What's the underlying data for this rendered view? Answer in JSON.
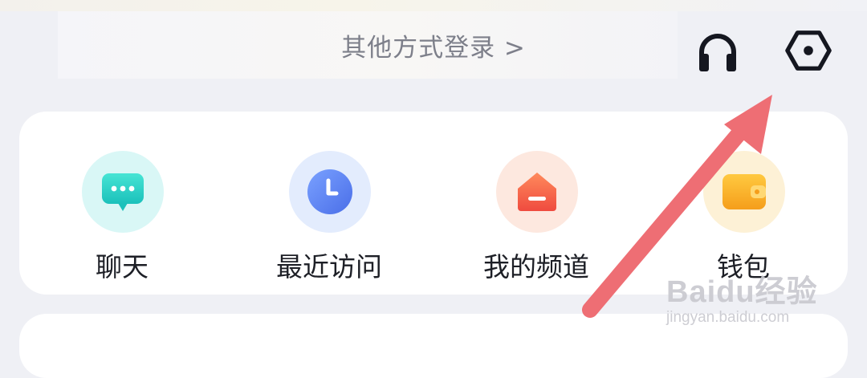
{
  "header": {
    "other_login_label": "其他方式登录 >",
    "icons": {
      "support": "headphones-icon",
      "settings": "settings-hexagon-icon"
    }
  },
  "shortcuts": [
    {
      "label": "聊天",
      "icon": "chat-bubble-icon",
      "color": "#2ed3c6"
    },
    {
      "label": "最近访问",
      "icon": "clock-icon",
      "color": "#5b86f2"
    },
    {
      "label": "我的频道",
      "icon": "house-icon",
      "color": "#f26a4b"
    },
    {
      "label": "钱包",
      "icon": "wallet-icon",
      "color": "#f7b32b"
    }
  ],
  "watermark": {
    "brand": "Baidu经验",
    "url": "jingyan.baidu.com"
  },
  "colors": {
    "annotation_arrow": "#ee6e74",
    "background": "#eff0f5"
  }
}
